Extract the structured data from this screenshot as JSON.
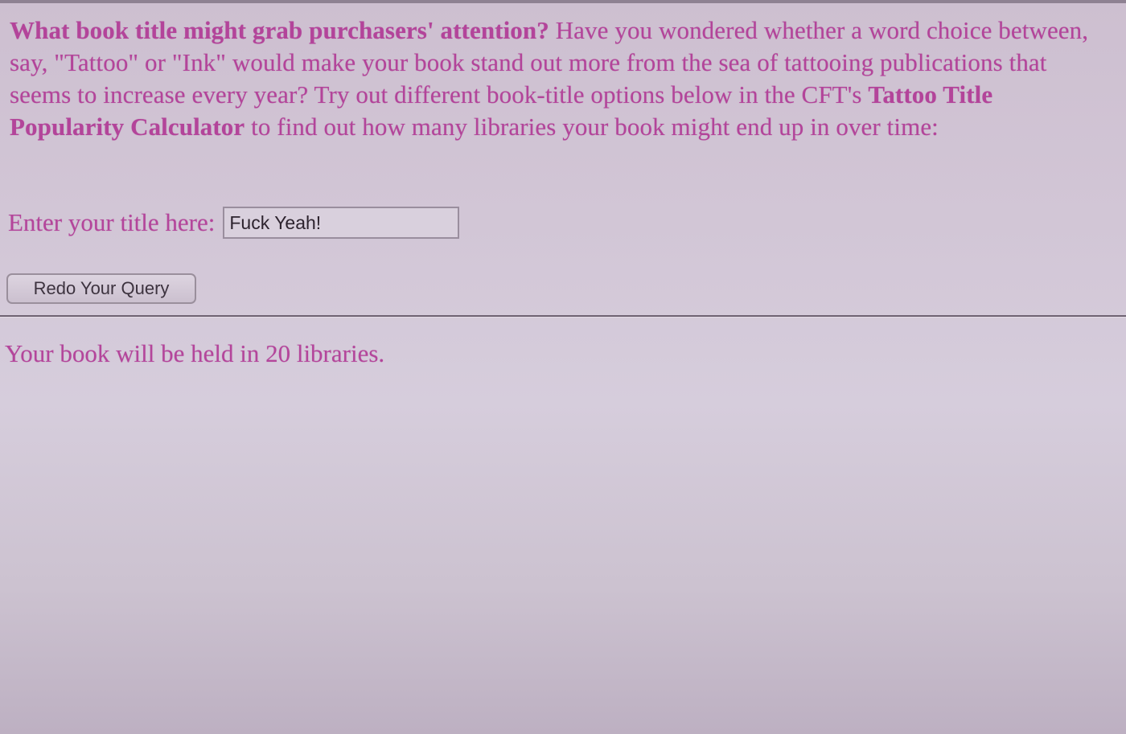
{
  "intro": {
    "bold_lead": "What book title might grab purchasers' attention?",
    "text_part_1": " Have you wondered whether a word choice between, say, \"Tattoo\" or \"Ink\" would make your book stand out more from the sea of tattooing publications that seems to increase every year? Try out different book-title options below in the CFT's ",
    "bold_calculator": "Tattoo Title Popularity Calculator",
    "text_part_2": " to find out how many libraries your book might end up in over time:"
  },
  "form": {
    "label": "Enter your title here:",
    "title_value": "Fuck Yeah!",
    "redo_button_label": "Redo Your Query"
  },
  "result": {
    "text": "Your book will be held in 20 libraries."
  },
  "colors": {
    "text_accent": "#b4459b",
    "background": "#d2c6d6"
  }
}
